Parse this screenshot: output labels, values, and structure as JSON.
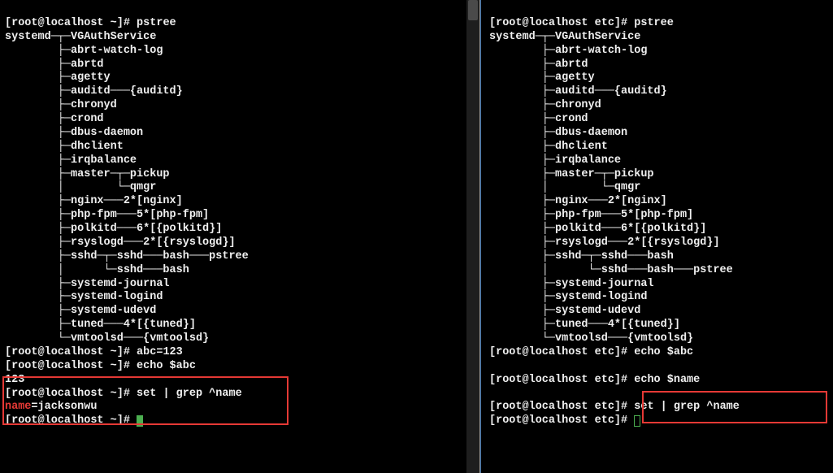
{
  "left": {
    "prompt_home": "[root@localhost ~]#",
    "cmd_pstree": "pstree",
    "tree": [
      "systemd─┬─VGAuthService",
      "        ├─abrt-watch-log",
      "        ├─abrtd",
      "        ├─agetty",
      "        ├─auditd───{auditd}",
      "        ├─chronyd",
      "        ├─crond",
      "        ├─dbus-daemon",
      "        ├─dhclient",
      "        ├─irqbalance",
      "        ├─master─┬─pickup",
      "        │        └─qmgr",
      "        ├─nginx───2*[nginx]",
      "        ├─php-fpm───5*[php-fpm]",
      "        ├─polkitd───6*[{polkitd}]",
      "        ├─rsyslogd───2*[{rsyslogd}]",
      "        ├─sshd─┬─sshd───bash───pstree",
      "        │      └─sshd───bash",
      "        ├─systemd-journal",
      "        ├─systemd-logind",
      "        ├─systemd-udevd",
      "        ├─tuned───4*[{tuned}]",
      "        └─vmtoolsd───{vmtoolsd}"
    ],
    "cmd_abc_set": "abc=123",
    "cmd_echo_abc": "echo $abc",
    "echo_abc_out": "123",
    "cmd_grep": "set | grep ^name",
    "grep_hl": "name",
    "grep_rest": "=jacksonwu"
  },
  "right": {
    "prompt_etc": "[root@localhost etc]#",
    "cmd_pstree": "pstree",
    "tree": [
      "systemd─┬─VGAuthService",
      "        ├─abrt-watch-log",
      "        ├─abrtd",
      "        ├─agetty",
      "        ├─auditd───{auditd}",
      "        ├─chronyd",
      "        ├─crond",
      "        ├─dbus-daemon",
      "        ├─dhclient",
      "        ├─irqbalance",
      "        ├─master─┬─pickup",
      "        │        └─qmgr",
      "        ├─nginx───2*[nginx]",
      "        ├─php-fpm───5*[php-fpm]",
      "        ├─polkitd───6*[{polkitd}]",
      "        ├─rsyslogd───2*[{rsyslogd}]",
      "        ├─sshd─┬─sshd───bash",
      "        │      └─sshd───bash───pstree",
      "        ├─systemd-journal",
      "        ├─systemd-logind",
      "        ├─systemd-udevd",
      "        ├─tuned───4*[{tuned}]",
      "        └─vmtoolsd───{vmtoolsd}"
    ],
    "cmd_echo_abc": "echo $abc",
    "blank1": "",
    "cmd_echo_name": "echo $name",
    "blank2": "",
    "cmd_grep": "set | grep ^name"
  }
}
